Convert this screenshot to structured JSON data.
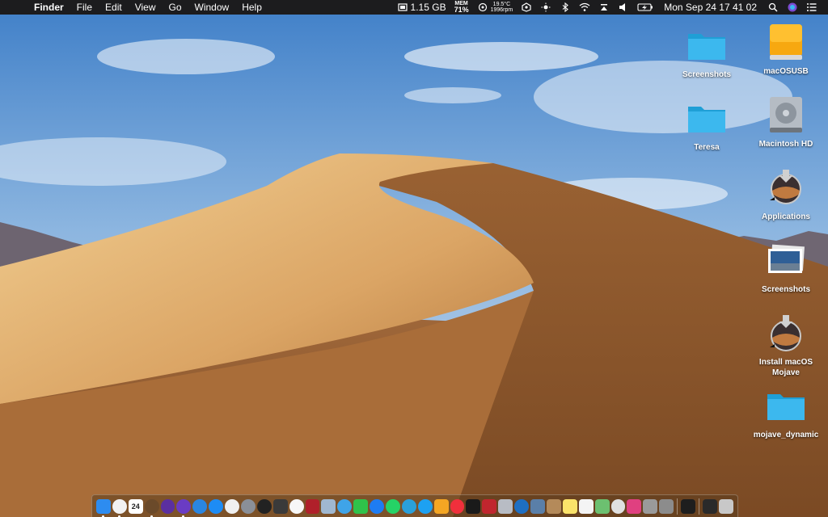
{
  "menubar": {
    "app_name": "Finder",
    "menus": [
      "File",
      "Edit",
      "View",
      "Go",
      "Window",
      "Help"
    ],
    "memory_used": "1.15 GB",
    "mem_label": "MEM",
    "mem_percent": "71%",
    "temperature": "19.5°C",
    "fan_speed": "1996rpm",
    "clock": "Mon Sep 24  17 41 02",
    "icons": [
      "memory-icon",
      "cpu-icon",
      "gear-icon",
      "brightness-icon",
      "bluetooth-icon",
      "wifi-icon",
      "airplay-icon",
      "volume-icon",
      "battery-icon",
      "spotlight-icon",
      "siri-icon",
      "notification-center-icon"
    ]
  },
  "desktop": {
    "items": [
      {
        "label": "Screenshots",
        "icon": "folder-icon"
      },
      {
        "label": "macOSUSB",
        "icon": "external-drive-icon"
      },
      {
        "label": "Teresa",
        "icon": "folder-icon"
      },
      {
        "label": "Macintosh HD",
        "icon": "hard-drive-icon"
      },
      {
        "label": "Applications",
        "icon": "installer-alias-icon"
      },
      {
        "label": "Screenshots",
        "icon": "image-stack-icon"
      },
      {
        "label": "Install macOS Mojave",
        "icon": "installer-icon"
      },
      {
        "label": "mojave_dynamic",
        "icon": "folder-icon"
      }
    ]
  },
  "dock": {
    "calendar_day": "24",
    "items": [
      {
        "name": "finder",
        "color": "#2d8cf0",
        "running": true
      },
      {
        "name": "clock",
        "color": "#f2f2f2",
        "running": true
      },
      {
        "name": "calendar",
        "color": "#ffffff",
        "running": false
      },
      {
        "name": "weather",
        "color": "#6b4a2a",
        "running": true
      },
      {
        "name": "firefox-nightly",
        "color": "#5b2fa0",
        "running": false
      },
      {
        "name": "siri",
        "color": "#6a3cc4",
        "running": true
      },
      {
        "name": "safari",
        "color": "#2a86e0",
        "running": false
      },
      {
        "name": "app-store",
        "color": "#1d8cf5",
        "running": false
      },
      {
        "name": "itunes",
        "color": "#f0f0f0",
        "running": false
      },
      {
        "name": "launchpad",
        "color": "#8a8f98",
        "running": false
      },
      {
        "name": "dashboard",
        "color": "#222222",
        "running": false
      },
      {
        "name": "mission-control",
        "color": "#3a3a3a",
        "running": false
      },
      {
        "name": "photos",
        "color": "#f7f7f7",
        "running": false
      },
      {
        "name": "photo-booth",
        "color": "#b0202a",
        "running": false
      },
      {
        "name": "preview",
        "color": "#a0b8d0",
        "running": false
      },
      {
        "name": "messages-bubble",
        "color": "#3fa4e8",
        "running": false
      },
      {
        "name": "facetime",
        "color": "#2fc24a",
        "running": false
      },
      {
        "name": "messenger",
        "color": "#1e7cf2",
        "running": false
      },
      {
        "name": "whatsapp",
        "color": "#25d366",
        "running": false
      },
      {
        "name": "telegram",
        "color": "#2aa0da",
        "running": false
      },
      {
        "name": "twitter",
        "color": "#1da1f2",
        "running": false
      },
      {
        "name": "home",
        "color": "#f5a623",
        "running": false
      },
      {
        "name": "news",
        "color": "#f0303c",
        "running": false
      },
      {
        "name": "stocks",
        "color": "#1a1a1a",
        "running": false
      },
      {
        "name": "photo-editor",
        "color": "#c0262e",
        "running": false
      },
      {
        "name": "disk-utility",
        "color": "#b8bcc4",
        "running": false
      },
      {
        "name": "edge",
        "color": "#1f6fc2",
        "running": false
      },
      {
        "name": "scanner",
        "color": "#5a7fa8",
        "running": false
      },
      {
        "name": "contacts",
        "color": "#b48a5a",
        "running": false
      },
      {
        "name": "notes",
        "color": "#fbe36a",
        "running": false
      },
      {
        "name": "textedit",
        "color": "#f4f4f4",
        "running": false
      },
      {
        "name": "maps",
        "color": "#6cc070",
        "running": false
      },
      {
        "name": "chess",
        "color": "#e0e0e0",
        "running": false
      },
      {
        "name": "instastats",
        "color": "#e04080",
        "running": false
      },
      {
        "name": "automator",
        "color": "#9a9a9a",
        "running": false
      },
      {
        "name": "system-preferences",
        "color": "#8c8c8c",
        "running": false
      },
      {
        "name": "terminal",
        "color": "#1e1e1e",
        "running": false
      },
      {
        "name": "downloads-stack",
        "color": "#2a2a2a",
        "running": false
      },
      {
        "name": "trash",
        "color": "#c8c8c8",
        "running": false
      }
    ]
  }
}
